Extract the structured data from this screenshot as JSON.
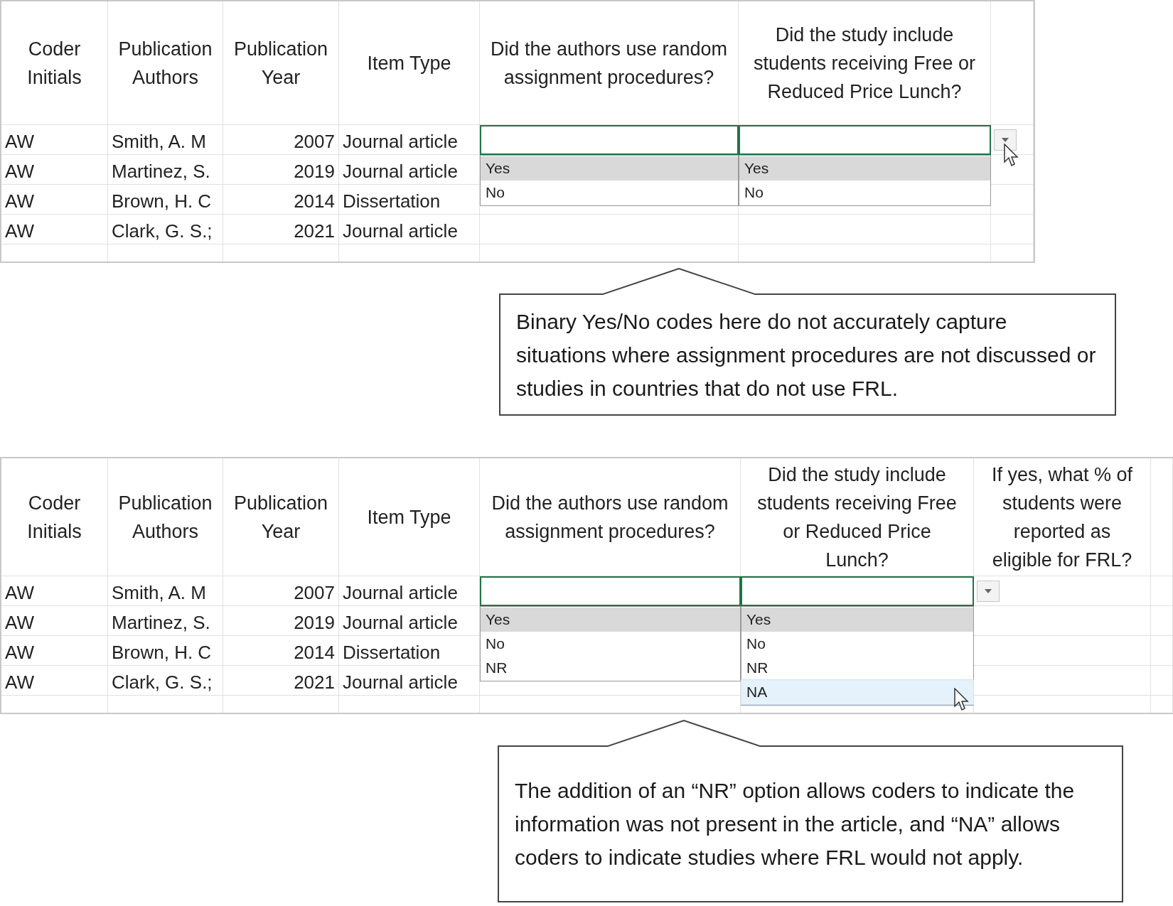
{
  "panels": [
    {
      "table": {
        "columns": [
          "Coder Initials",
          "Publication Authors",
          "Publication Year",
          "Item Type",
          "Did the authors use random assignment procedures?",
          "Did the study include students receiving Free or Reduced Price Lunch?"
        ],
        "rows": [
          [
            "AW",
            "Smith, A. M",
            "2007",
            "Journal article"
          ],
          [
            "AW",
            "Martinez, S.",
            "2019",
            "Journal article"
          ],
          [
            "AW",
            "Brown, H. C",
            "2014",
            "Dissertation"
          ],
          [
            "AW",
            "Clark, G. S.;",
            "2021",
            "Journal article"
          ]
        ]
      },
      "dropdowns": [
        {
          "arrow_button": false,
          "options": [
            {
              "label": "Yes",
              "selected": true,
              "hovered": false
            },
            {
              "label": "No",
              "selected": false,
              "hovered": false
            }
          ]
        },
        {
          "arrow_button": true,
          "options": [
            {
              "label": "Yes",
              "selected": true,
              "hovered": false
            },
            {
              "label": "No",
              "selected": false,
              "hovered": false
            }
          ]
        }
      ],
      "callout": "Binary Yes/No codes here do not accurately capture situations where assignment procedures are not discussed or studies in countries that do not use FRL."
    },
    {
      "table": {
        "columns": [
          "Coder Initials",
          "Publication Authors",
          "Publication Year",
          "Item Type",
          "Did the authors use random assignment procedures?",
          "Did the study include students receiving Free or Reduced Price Lunch?",
          "If yes, what % of students were reported as eligible for FRL?"
        ],
        "rows": [
          [
            "AW",
            "Smith, A. M",
            "2007",
            "Journal article"
          ],
          [
            "AW",
            "Martinez, S.",
            "2019",
            "Journal article"
          ],
          [
            "AW",
            "Brown, H. C",
            "2014",
            "Dissertation"
          ],
          [
            "AW",
            "Clark, G. S.;",
            "2021",
            "Journal article"
          ]
        ]
      },
      "dropdowns": [
        {
          "arrow_button": false,
          "options": [
            {
              "label": "Yes",
              "selected": true,
              "hovered": false
            },
            {
              "label": "No",
              "selected": false,
              "hovered": false
            },
            {
              "label": "NR",
              "selected": false,
              "hovered": false
            }
          ]
        },
        {
          "arrow_button": true,
          "options": [
            {
              "label": "Yes",
              "selected": true,
              "hovered": false
            },
            {
              "label": "No",
              "selected": false,
              "hovered": false
            },
            {
              "label": "NR",
              "selected": false,
              "hovered": false
            },
            {
              "label": "NA",
              "selected": false,
              "hovered": true
            }
          ]
        }
      ],
      "callout": "The addition of an “NR” option allows coders to indicate the information was not present in the article, and “NA” allows coders to indicate studies where FRL would not apply."
    }
  ]
}
